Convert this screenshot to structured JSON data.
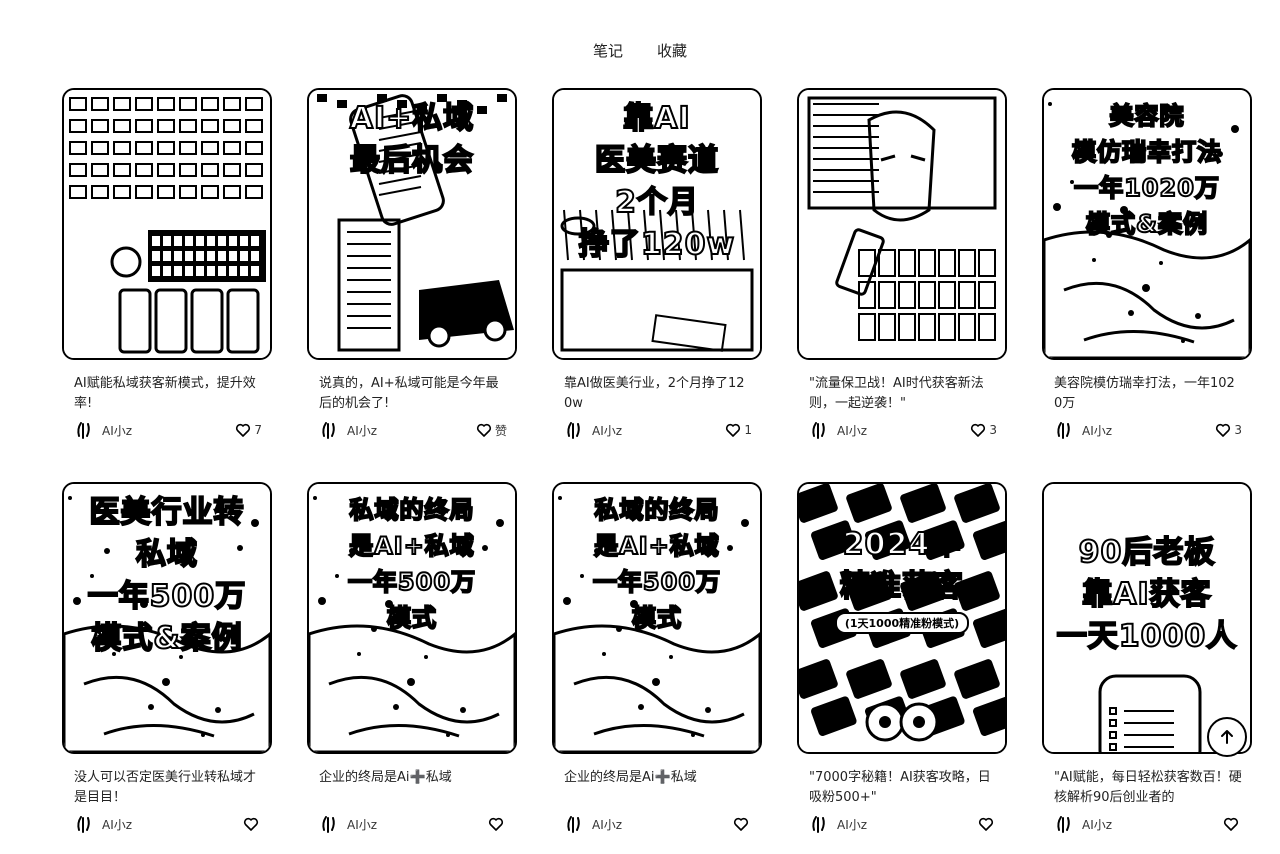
{
  "tabs": [
    {
      "label": "笔记"
    },
    {
      "label": "收藏"
    }
  ],
  "cards": [
    {
      "overlay": [],
      "title": "AI赋能私域获客新模式，提升效率!",
      "author": "AI小z",
      "likes": "7",
      "style": "keyboard"
    },
    {
      "overlay": [
        "AI+私域",
        "最后机会"
      ],
      "title": "说真的，AI+私域可能是今年最后的机会了!",
      "author": "AI小z",
      "likes": "赞",
      "style": "phone"
    },
    {
      "overlay": [
        "靠AI",
        "医美赛道",
        "2个月",
        "挣了120w"
      ],
      "title": "靠AI做医美行业，2个月挣了120w",
      "author": "AI小z",
      "likes": "1",
      "style": "desk"
    },
    {
      "overlay": [],
      "title": "\"流量保卫战！AI时代获客新法则，一起逆袭！\"",
      "author": "AI小z",
      "likes": "3",
      "style": "anime"
    },
    {
      "overlay": [
        "美容院",
        "模仿瑞幸打法",
        "一年1020万",
        "模式&案例"
      ],
      "title": "美容院模仿瑞幸打法，一年1020万",
      "author": "AI小z",
      "likes": "3",
      "style": "person"
    },
    {
      "overlay": [
        "医美行业转",
        "私域",
        "一年500万",
        "模式&案例"
      ],
      "title": "没人可以否定医美行业转私域才是目目！",
      "author": "AI小z",
      "likes": "",
      "style": "person"
    },
    {
      "overlay": [
        "私域的终局",
        "是AI+私域",
        "一年500万",
        "模式"
      ],
      "title": "企业的终局是Ai➕私域",
      "author": "AI小z",
      "likes": "",
      "style": "person"
    },
    {
      "overlay": [
        "私域的终局",
        "是AI+私域",
        "一年500万",
        "模式"
      ],
      "title": "企业的终局是Ai➕私域",
      "author": "AI小z",
      "likes": "",
      "style": "person"
    },
    {
      "overlay": [
        "2024年",
        "精准获客"
      ],
      "pill": "(1天1000精准粉模式)",
      "title": "\"7000字秘籍！AI获客攻略，日吸粉500+\"",
      "author": "AI小z",
      "likes": "",
      "style": "phones"
    },
    {
      "overlay": [
        "90后老板",
        "靠AI获客",
        "一天1000人"
      ],
      "title": "\"AI赋能，每日轻松获客数百！硬核解析90后创业者的",
      "author": "AI小z",
      "likes": "",
      "style": "white"
    }
  ],
  "back_to_top_icon": "arrow-up-icon"
}
